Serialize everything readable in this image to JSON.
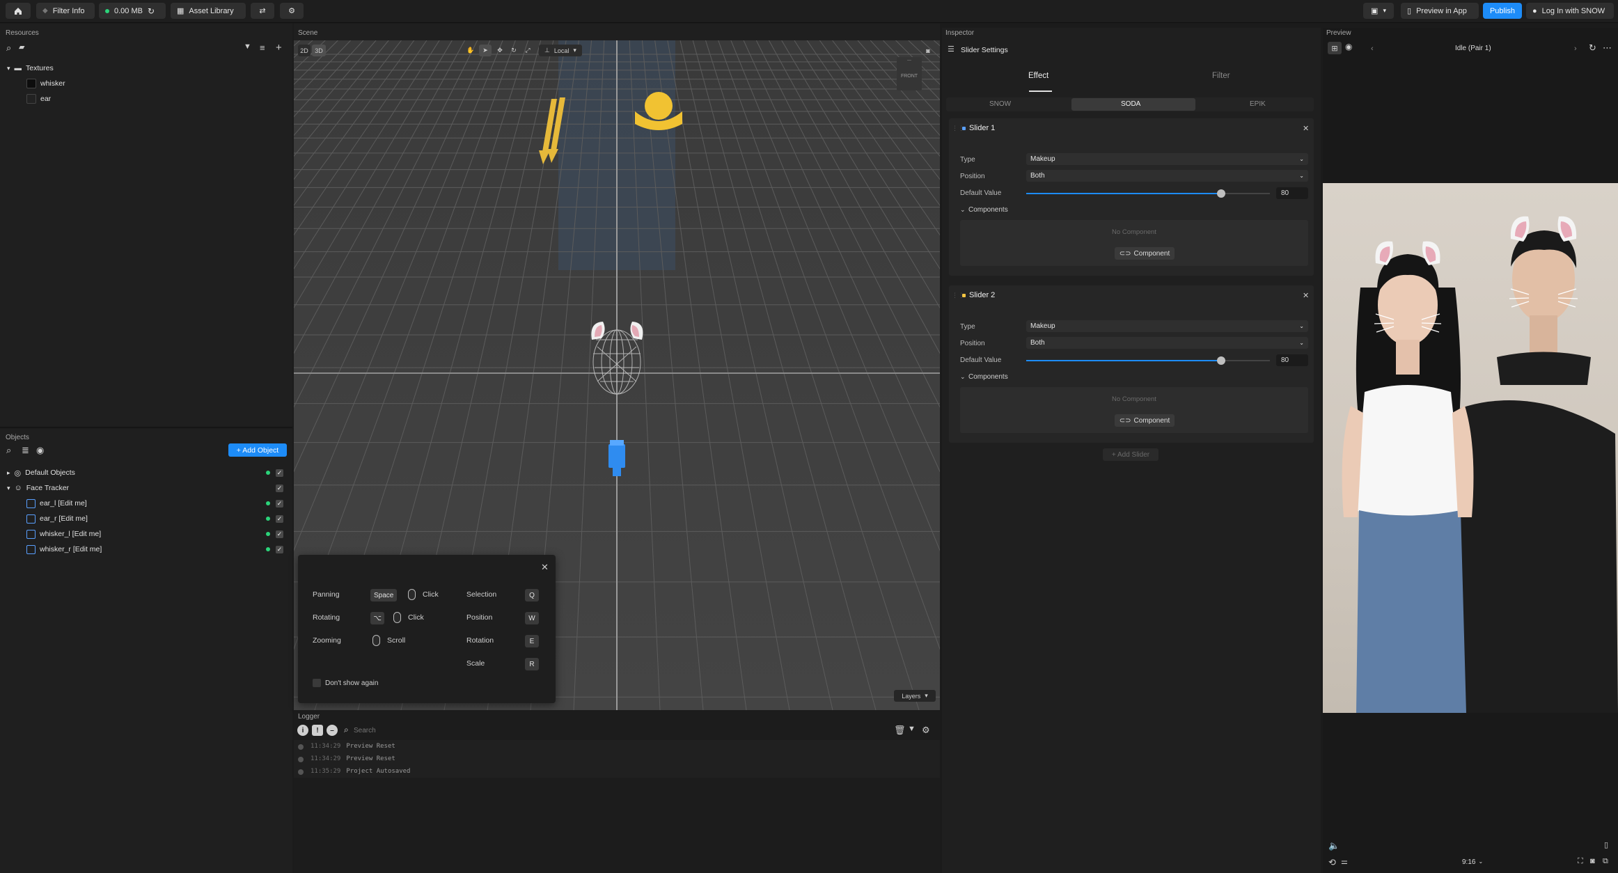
{
  "toolbar": {
    "filter_info": "Filter Info",
    "memory": "0.00 MB",
    "asset_library": "Asset Library",
    "preview_in_app": "Preview in App",
    "publish": "Publish",
    "login": "Log In with SNOW"
  },
  "resources": {
    "title": "Resources",
    "folder": "Textures",
    "items": [
      {
        "label": "whisker"
      },
      {
        "label": "ear"
      }
    ]
  },
  "objects": {
    "title": "Objects",
    "add_button": "+ Add Object",
    "items": [
      {
        "label": "Default Objects"
      },
      {
        "label": "Face Tracker"
      },
      {
        "label": "ear_l [Edit me]"
      },
      {
        "label": "ear_r [Edit me]"
      },
      {
        "label": "whisker_l [Edit me]"
      },
      {
        "label": "whisker_r [Edit me]"
      }
    ]
  },
  "scene": {
    "title": "Scene",
    "mode_2d": "2D",
    "mode_3d": "3D",
    "space": "Local",
    "front": "FRONT",
    "layers": "Layers"
  },
  "shortcuts": {
    "panning": "Panning",
    "rotating": "Rotating",
    "zooming": "Zooming",
    "space_key": "Space",
    "alt_key": "⌥",
    "click": "Click",
    "scroll": "Scroll",
    "selection": "Selection",
    "position": "Position",
    "rotation": "Rotation",
    "scale": "Scale",
    "key_q": "Q",
    "key_w": "W",
    "key_e": "E",
    "key_r": "R",
    "dont_show": "Don't show again"
  },
  "logger": {
    "title": "Logger",
    "search_placeholder": "Search",
    "entries": [
      {
        "time": "11:34:29",
        "msg": "Preview Reset"
      },
      {
        "time": "11:34:29",
        "msg": "Preview Reset"
      },
      {
        "time": "11:35:29",
        "msg": "Project Autosaved"
      }
    ]
  },
  "inspector": {
    "title": "Inspector",
    "section": "Slider Settings",
    "tabs": [
      "Effect",
      "Filter"
    ],
    "platforms": [
      "SNOW",
      "SODA",
      "EPIK"
    ],
    "sliders": [
      {
        "name": "Slider 1",
        "type_label": "Type",
        "type": "Makeup",
        "position_label": "Position",
        "position": "Both",
        "default_label": "Default Value",
        "default_value": "80",
        "components_label": "Components",
        "no_component": "No Component",
        "component_btn": "Component"
      },
      {
        "name": "Slider 2",
        "type_label": "Type",
        "type": "Makeup",
        "position_label": "Position",
        "position": "Both",
        "default_label": "Default Value",
        "default_value": "80",
        "components_label": "Components",
        "no_component": "No Component",
        "component_btn": "Component"
      }
    ],
    "add_slider": "+ Add Slider"
  },
  "preview": {
    "title": "Preview",
    "state": "Idle (Pair 1)",
    "ratio": "9:16"
  },
  "colors": {
    "accent": "#1d8cf8",
    "green": "#2bd47a",
    "slider1_dot": "#5aa0ff",
    "slider2_dot": "#f5c542"
  }
}
